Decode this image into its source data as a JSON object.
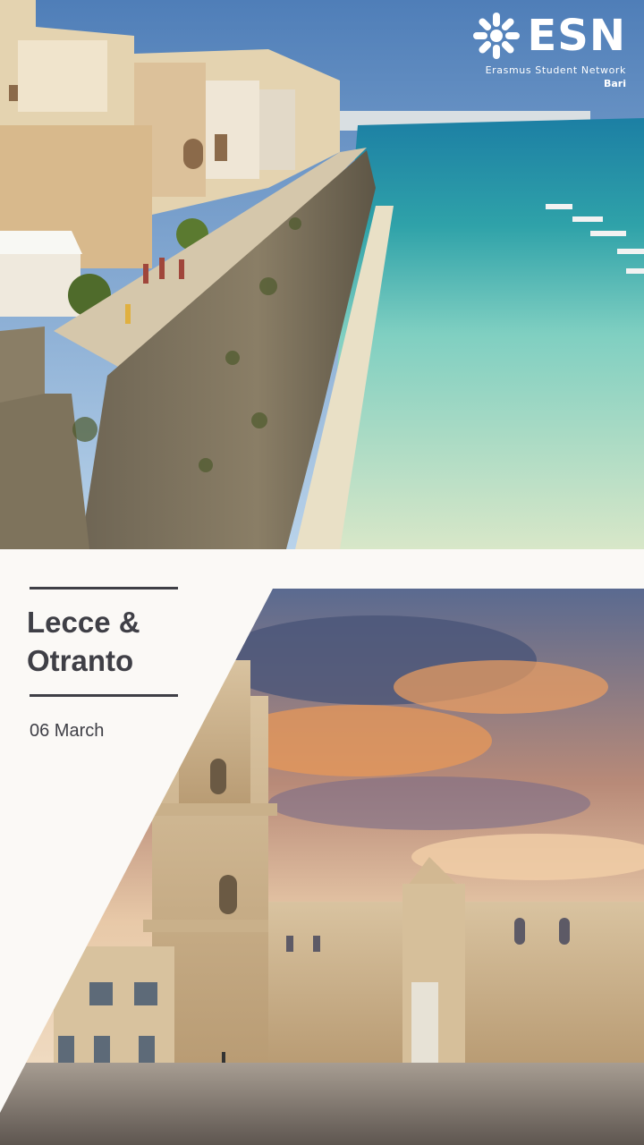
{
  "logo": {
    "wordmark": "ESN",
    "network": "Erasmus Student Network",
    "section": "Bari"
  },
  "event": {
    "title_line1": "Lecce &",
    "title_line2": "Otranto",
    "date": "06 March"
  },
  "colors": {
    "text": "#3f3f46",
    "panel": "#fbf9f6",
    "sea": "#7cc9bd",
    "sky": "#4f7eb8"
  }
}
